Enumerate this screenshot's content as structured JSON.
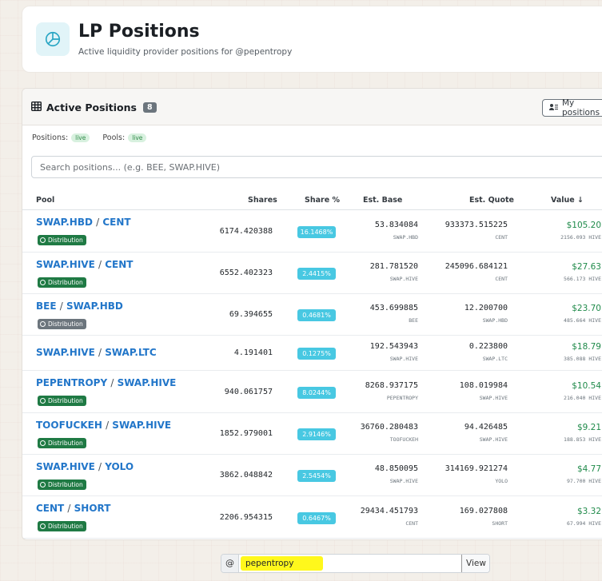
{
  "header": {
    "title": "LP Positions",
    "subtitle": "Active liquidity provider positions for @pepentropy",
    "logo_icon": "pie-chart-icon"
  },
  "card": {
    "title": "Active Positions",
    "count": "8",
    "my_positions_label": "My positions",
    "status": {
      "positions_label": "Positions:",
      "positions_status": "live",
      "pools_label": "Pools:",
      "pools_status": "live"
    },
    "search_placeholder": "Search positions... (e.g. BEE, SWAP.HIVE)"
  },
  "table": {
    "columns": {
      "pool": "Pool",
      "shares": "Shares",
      "share_pct": "Share %",
      "est_base": "Est. Base",
      "est_quote": "Est. Quote",
      "value": "Value ↓"
    },
    "rows": [
      {
        "base": "SWAP.HBD",
        "quote": "CENT",
        "sep": "/",
        "badge": "Distribution",
        "shares": "6174.420388",
        "share_pct": "16.1468%",
        "est_base": "53.834084",
        "base_sym": "SWAP.HBD",
        "est_quote": "933373.515225",
        "quote_sym": "CENT",
        "value_usd": "$105.20",
        "value_hive": "2156.093 HIVE"
      },
      {
        "base": "SWAP.HIVE",
        "quote": "CENT",
        "sep": "/",
        "badge": "Distribution",
        "shares": "6552.402323",
        "share_pct": "2.4415%",
        "est_base": "281.781520",
        "base_sym": "SWAP.HIVE",
        "est_quote": "245096.684121",
        "quote_sym": "CENT",
        "value_usd": "$27.63",
        "value_hive": "566.173 HIVE"
      },
      {
        "base": "BEE",
        "quote": "SWAP.HBD",
        "sep": "/",
        "badge": "Distribution",
        "shares": "69.394655",
        "share_pct": "0.4681%",
        "est_base": "453.699885",
        "base_sym": "BEE",
        "est_quote": "12.200700",
        "quote_sym": "SWAP.HBD",
        "value_usd": "$23.70",
        "value_hive": "485.664 HIVE"
      },
      {
        "base": "SWAP.HIVE",
        "quote": "SWAP.LTC",
        "sep": "/",
        "badge": "",
        "shares": "4.191401",
        "share_pct": "0.1275%",
        "est_base": "192.543943",
        "base_sym": "SWAP.HIVE",
        "est_quote": "0.223800",
        "quote_sym": "SWAP.LTC",
        "value_usd": "$18.79",
        "value_hive": "385.088 HIVE"
      },
      {
        "base": "PEPENTROPY",
        "quote": "SWAP.HIVE",
        "sep": "/",
        "badge": "Distribution",
        "shares": "940.061757",
        "share_pct": "8.0244%",
        "est_base": "8268.937175",
        "base_sym": "PEPENTROPY",
        "est_quote": "108.019984",
        "quote_sym": "SWAP.HIVE",
        "value_usd": "$10.54",
        "value_hive": "216.040 HIVE"
      },
      {
        "base": "TOOFUCKEH",
        "quote": "SWAP.HIVE",
        "sep": "/",
        "badge": "Distribution",
        "shares": "1852.979001",
        "share_pct": "2.9146%",
        "est_base": "36760.280483",
        "base_sym": "TOOFUCKEH",
        "est_quote": "94.426485",
        "quote_sym": "SWAP.HIVE",
        "value_usd": "$9.21",
        "value_hive": "188.853 HIVE"
      },
      {
        "base": "SWAP.HIVE",
        "quote": "YOLO",
        "sep": "/",
        "badge": "Distribution",
        "shares": "3862.048842",
        "share_pct": "2.5454%",
        "est_base": "48.850095",
        "base_sym": "SWAP.HIVE",
        "est_quote": "314169.921274",
        "quote_sym": "YOLO",
        "value_usd": "$4.77",
        "value_hive": "97.700 HIVE"
      },
      {
        "base": "CENT",
        "quote": "SHORT",
        "sep": "/",
        "badge": "Distribution",
        "shares": "2206.954315",
        "share_pct": "0.6467%",
        "est_base": "29434.451793",
        "base_sym": "CENT",
        "est_quote": "169.027808",
        "quote_sym": "SHORT",
        "value_usd": "$3.32",
        "value_hive": "67.994 HIVE"
      }
    ]
  },
  "footer": {
    "at_symbol": "@",
    "username": "pepentropy",
    "view_label": "View"
  },
  "colors": {
    "link": "#2276c9",
    "distribution_badge": "#1f7a44",
    "distribution_badge_muted": "#6c757d",
    "share_pill": "#48c8e2",
    "value_green": "#1f8a4a",
    "highlight": "#fff81c"
  }
}
